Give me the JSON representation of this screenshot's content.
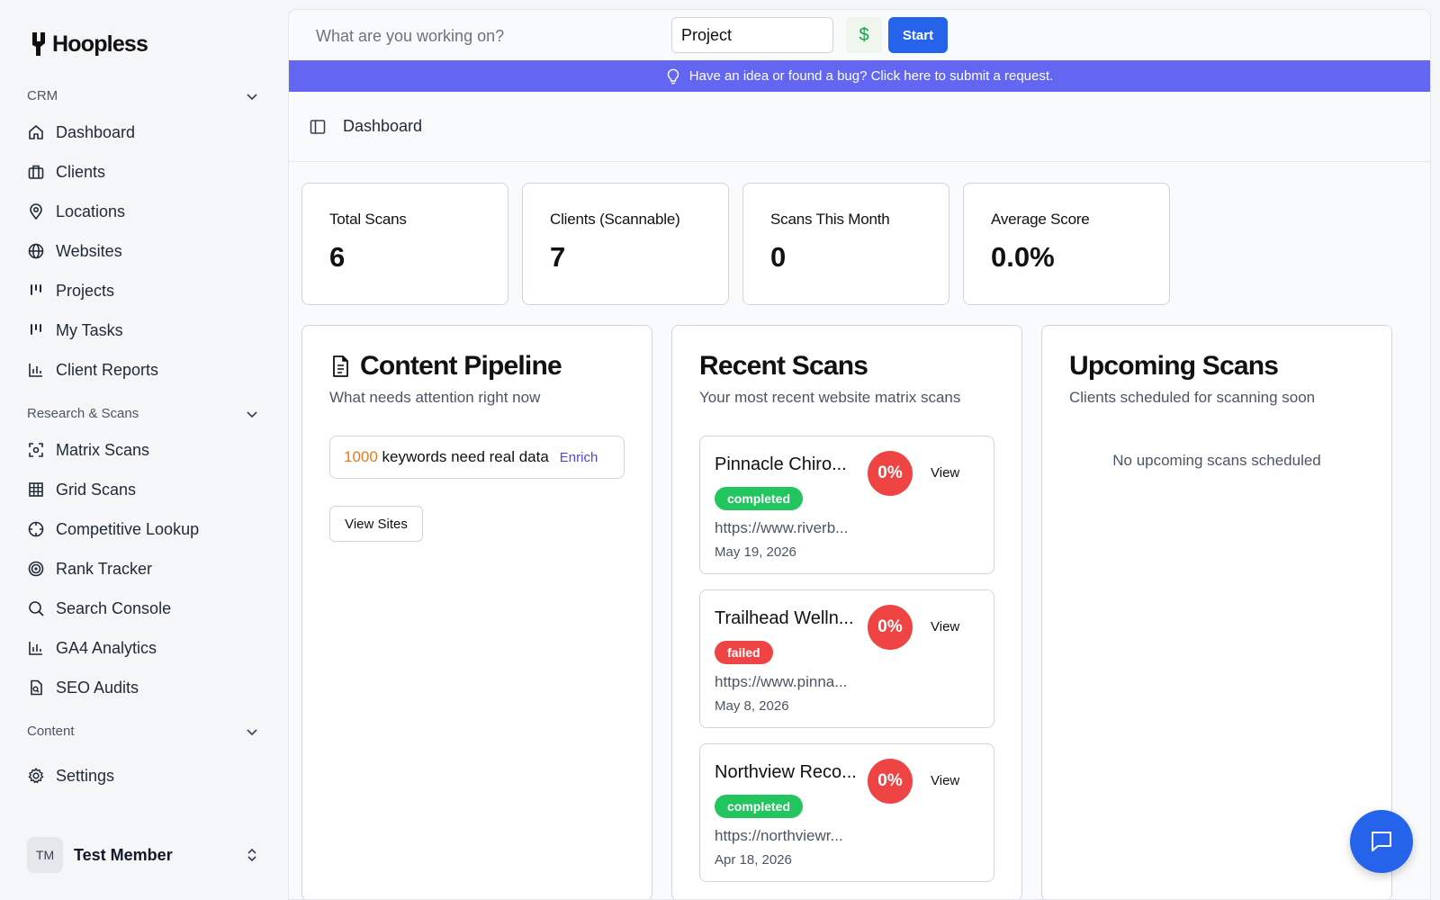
{
  "brand": {
    "name": "Hoopless"
  },
  "sidebar": {
    "groups": [
      {
        "label": "CRM"
      },
      {
        "label": "Research & Scans"
      },
      {
        "label": "Content"
      }
    ],
    "items": [
      {
        "label": "Dashboard",
        "icon": "home-icon"
      },
      {
        "label": "Clients",
        "icon": "briefcase-icon"
      },
      {
        "label": "Locations",
        "icon": "map-pin-icon"
      },
      {
        "label": "Websites",
        "icon": "globe-icon"
      },
      {
        "label": "Projects",
        "icon": "kanban-icon"
      },
      {
        "label": "My Tasks",
        "icon": "kanban-icon"
      },
      {
        "label": "Client Reports",
        "icon": "bar-chart-icon"
      },
      {
        "label": "Matrix Scans",
        "icon": "scan-icon"
      },
      {
        "label": "Grid Scans",
        "icon": "grid-icon"
      },
      {
        "label": "Competitive Lookup",
        "icon": "crosshair-icon"
      },
      {
        "label": "Rank Tracker",
        "icon": "target-icon"
      },
      {
        "label": "Search Console",
        "icon": "search-icon"
      },
      {
        "label": "GA4 Analytics",
        "icon": "bar-chart-icon"
      },
      {
        "label": "SEO Audits",
        "icon": "file-search-icon"
      },
      {
        "label": "Settings",
        "icon": "gear-icon"
      }
    ],
    "user": {
      "initials": "TM",
      "name": "Test Member"
    }
  },
  "topbar": {
    "work_placeholder": "What are you working on?",
    "project_value": "Project",
    "dollar_label": "$",
    "start_label": "Start"
  },
  "banner": {
    "text": "Have an idea or found a bug? Click here to submit a request."
  },
  "header": {
    "title": "Dashboard"
  },
  "stats": [
    {
      "label": "Total Scans",
      "value": "6"
    },
    {
      "label": "Clients (Scannable)",
      "value": "7"
    },
    {
      "label": "Scans This Month",
      "value": "0"
    },
    {
      "label": "Average Score",
      "value": "0.0%"
    }
  ],
  "pipeline": {
    "title": "Content Pipeline",
    "subtitle": "What needs attention right now",
    "count": "1000",
    "message": " keywords need real data",
    "enrich_label": "Enrich",
    "view_sites_label": "View Sites"
  },
  "recent_scans": {
    "title": "Recent Scans",
    "subtitle": "Your most recent website matrix scans",
    "view_label": "View",
    "items": [
      {
        "name": "Pinnacle Chiro...",
        "score": "0%",
        "status": "completed",
        "url": "https://www.riverb...",
        "date": "May 19, 2026"
      },
      {
        "name": "Trailhead Welln...",
        "score": "0%",
        "status": "failed",
        "url": "https://www.pinna...",
        "date": "May 8, 2026"
      },
      {
        "name": "Northview Reco...",
        "score": "0%",
        "status": "completed",
        "url": "https://northviewr...",
        "date": "Apr 18, 2026"
      }
    ]
  },
  "upcoming_scans": {
    "title": "Upcoming Scans",
    "subtitle": "Clients scheduled for scanning soon",
    "empty_text": "No upcoming scans scheduled"
  },
  "colors": {
    "accent": "#2563eb",
    "banner": "#6366f1",
    "success": "#22c55e",
    "danger": "#ef4444",
    "highlight": "#ea7a1c"
  }
}
